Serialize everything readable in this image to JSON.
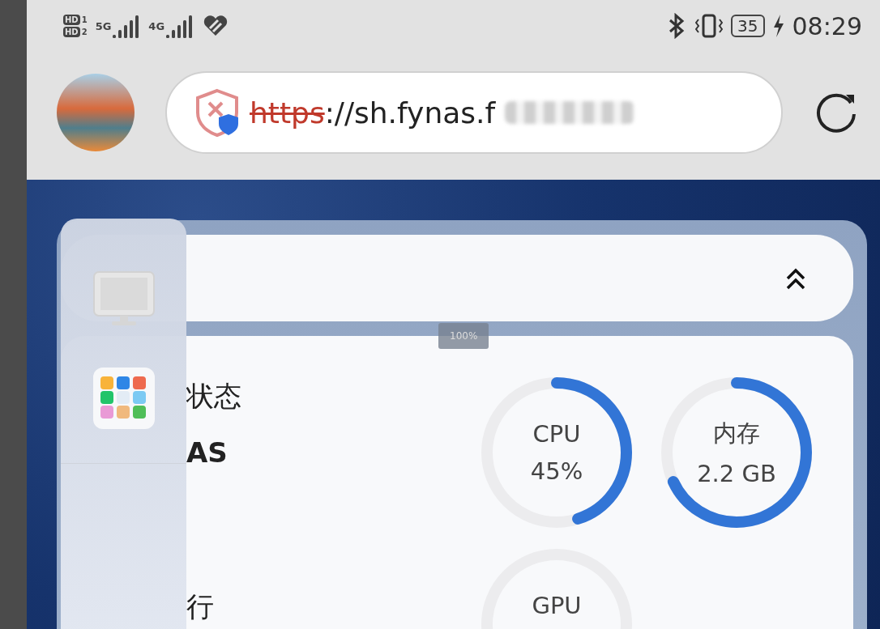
{
  "status_bar": {
    "sim_badges": [
      {
        "label": "HD",
        "slot": "1"
      },
      {
        "label": "HD",
        "slot": "2"
      }
    ],
    "networks": [
      "5G",
      "4G"
    ],
    "battery": "35",
    "time": "08:29"
  },
  "address_bar": {
    "scheme": "https",
    "address": "://sh.fynas.f",
    "secure": false
  },
  "dashboard": {
    "zoom_tip": "100%",
    "status_texts": [
      {
        "kind": "title",
        "text": "状态"
      },
      {
        "kind": "name",
        "text": "AS"
      },
      {
        "kind": "footer",
        "text": "行"
      }
    ],
    "gauges": [
      {
        "label": "CPU",
        "reading": "45%",
        "level": 0.45
      },
      {
        "label": "内存",
        "reading": "2.2 GB",
        "level": 0.68
      },
      {
        "label": "GPU"
      }
    ]
  }
}
